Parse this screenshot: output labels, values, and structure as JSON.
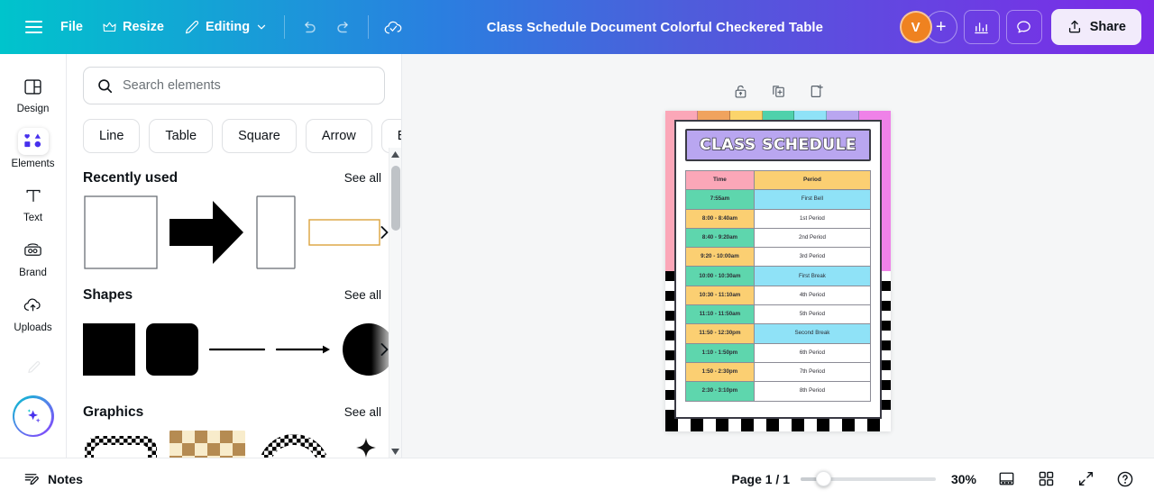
{
  "topbar": {
    "menu_icon": "hamburger-icon",
    "file_label": "File",
    "resize_label": "Resize",
    "resize_icon": "crown-icon",
    "editing_label": "Editing",
    "editing_icon": "pencil-icon",
    "editing_chevron": "chevron-down-icon",
    "undo_icon": "undo-icon",
    "redo_icon": "redo-icon",
    "cloud_icon": "cloud-saved-icon",
    "doc_title": "Class Schedule Document Colorful Checkered Table",
    "avatar_initial": "V",
    "add_person_icon": "plus-icon",
    "analytics_icon": "bar-chart-icon",
    "comment_icon": "comment-bubble-icon",
    "share_label": "Share",
    "share_icon": "upload-share-icon"
  },
  "rail": {
    "items": [
      {
        "label": "Design",
        "icon": "design-layout-icon",
        "active": false
      },
      {
        "label": "Elements",
        "icon": "elements-shapes-icon",
        "active": true
      },
      {
        "label": "Text",
        "icon": "text-t-icon",
        "active": false
      },
      {
        "label": "Brand",
        "icon": "brand-radio-icon",
        "active": false
      },
      {
        "label": "Uploads",
        "icon": "cloud-upload-icon",
        "active": false
      }
    ],
    "pen_icon": "pen-draw-icon",
    "magic_icon": "magic-sparkle-icon"
  },
  "panel": {
    "search": {
      "placeholder": "Search elements",
      "value": "",
      "icon": "search-icon"
    },
    "chips": [
      "Line",
      "Table",
      "Square",
      "Arrow",
      "Box"
    ],
    "chips_overflow_icon": "chevron-right-icon",
    "sections": [
      {
        "title": "Recently used",
        "see_all": "See all",
        "items": [
          "square-outline-thumb",
          "black-arrow-thumb",
          "vertical-rectangle-thumb",
          "orange-outline-rect-thumb"
        ]
      },
      {
        "title": "Shapes",
        "see_all": "See all",
        "items": [
          "black-square-thumb",
          "black-rounded-square-thumb",
          "line-thumb",
          "arrow-line-thumb",
          "black-circle-thumb"
        ]
      },
      {
        "title": "Graphics",
        "see_all": "See all",
        "items": [
          "checkered-frame-thumb",
          "checkerboard-tan-thumb",
          "checkered-circle-thumb",
          "sparkle-star-thumb"
        ]
      }
    ],
    "row_arrow_icon": "chevron-right-icon",
    "scrollbar": {
      "up_icon": "caret-up-icon",
      "down_icon": "caret-down-icon"
    }
  },
  "canvas": {
    "page_tools": [
      {
        "icon": "unlock-icon",
        "name": "lock-page-button"
      },
      {
        "icon": "duplicate-page-icon",
        "name": "duplicate-page-button"
      },
      {
        "icon": "add-page-icon",
        "name": "add-page-button"
      }
    ],
    "document": {
      "title": "CLASS SCHEDULE",
      "top_strip_colors": [
        "#fba7b8",
        "#f0a35e",
        "#fbd46b",
        "#4fd1ab",
        "#8fe2f7",
        "#b9a6f0",
        "#ef82e8"
      ],
      "left_band_color": "#fba7b8",
      "right_band_color": "#ef82e8",
      "title_bg": "#b9a6f0",
      "table": {
        "headers": [
          "Time",
          "Period"
        ],
        "rows": [
          {
            "time": "7:55am",
            "time_color": "green",
            "period": "First Bell",
            "period_type": "break"
          },
          {
            "time": "8:00 - 8:40am",
            "time_color": "yellow",
            "period": "1st Period",
            "period_type": "plain"
          },
          {
            "time": "8:40 - 9:20am",
            "time_color": "green",
            "period": "2nd Period",
            "period_type": "plain"
          },
          {
            "time": "9:20 - 10:00am",
            "time_color": "yellow",
            "period": "3rd Period",
            "period_type": "plain"
          },
          {
            "time": "10:00 - 10:30am",
            "time_color": "green",
            "period": "First Break",
            "period_type": "break"
          },
          {
            "time": "10:30 - 11:10am",
            "time_color": "yellow",
            "period": "4th Period",
            "period_type": "plain"
          },
          {
            "time": "11:10 - 11:50am",
            "time_color": "green",
            "period": "5th Period",
            "period_type": "plain"
          },
          {
            "time": "11:50 - 12:30pm",
            "time_color": "yellow",
            "period": "Second Break",
            "period_type": "break"
          },
          {
            "time": "1:10 - 1:50pm",
            "time_color": "green",
            "period": "6th Period",
            "period_type": "plain"
          },
          {
            "time": "1:50 - 2:30pm",
            "time_color": "yellow",
            "period": "7th Period",
            "period_type": "plain"
          },
          {
            "time": "2:30 - 3:10pm",
            "time_color": "green",
            "period": "8th Period",
            "period_type": "plain"
          }
        ]
      }
    }
  },
  "bottombar": {
    "notes_label": "Notes",
    "notes_icon": "notes-pencil-icon",
    "page_label": "Page 1 / 1",
    "zoom_percent": "30%",
    "view_icon": "page-view-icon",
    "grid_icon": "grid-view-icon",
    "fullscreen_icon": "expand-fullscreen-icon",
    "help_icon": "help-question-icon"
  }
}
